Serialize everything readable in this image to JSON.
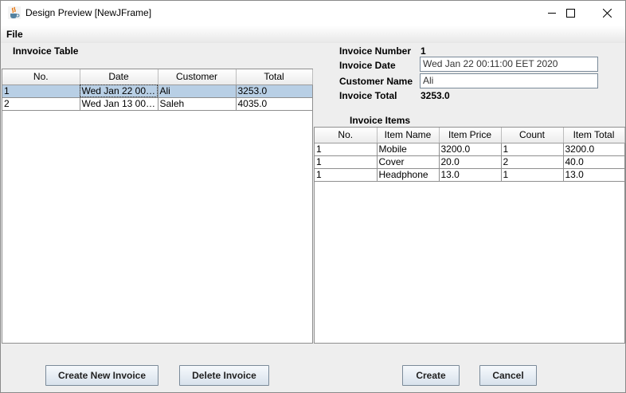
{
  "window": {
    "title": "Design Preview [NewJFrame]",
    "icon": "java-coffee-icon"
  },
  "menu": {
    "file": "File"
  },
  "invoice_table": {
    "title": "Innvoice Table",
    "columns": [
      "No.",
      "Date",
      "Customer",
      "Total"
    ],
    "rows": [
      [
        "1",
        "Wed Jan 22 00:...",
        "Ali",
        "3253.0"
      ],
      [
        "2",
        "Wed Jan 13 00:...",
        "Saleh",
        "4035.0"
      ]
    ]
  },
  "invoice_header": {
    "number_label": "Invoice Number",
    "number_value": "1",
    "date_label": "Invoice Date",
    "date_value": "Wed Jan 22 00:11:00 EET 2020",
    "customer_label": "Customer Name",
    "customer_value": "Ali",
    "total_label": "Invoice Total",
    "total_value": "3253.0"
  },
  "invoice_items": {
    "title": "Invoice Items",
    "columns": [
      "No.",
      "Item Name",
      "Item Price",
      "Count",
      "Item Total"
    ],
    "rows": [
      [
        "1",
        "Mobile",
        "3200.0",
        "1",
        "3200.0"
      ],
      [
        "1",
        "Cover",
        "20.0",
        "2",
        "40.0"
      ],
      [
        "1",
        "Headphone",
        "13.0",
        "1",
        "13.0"
      ]
    ]
  },
  "buttons": {
    "create_invoice": "Create New Invoice",
    "delete_invoice": "Delete Invoice",
    "create": "Create",
    "cancel": "Cancel"
  },
  "colors": {
    "selection": "#b8cfe5",
    "window_bg": "#eeeeee"
  }
}
